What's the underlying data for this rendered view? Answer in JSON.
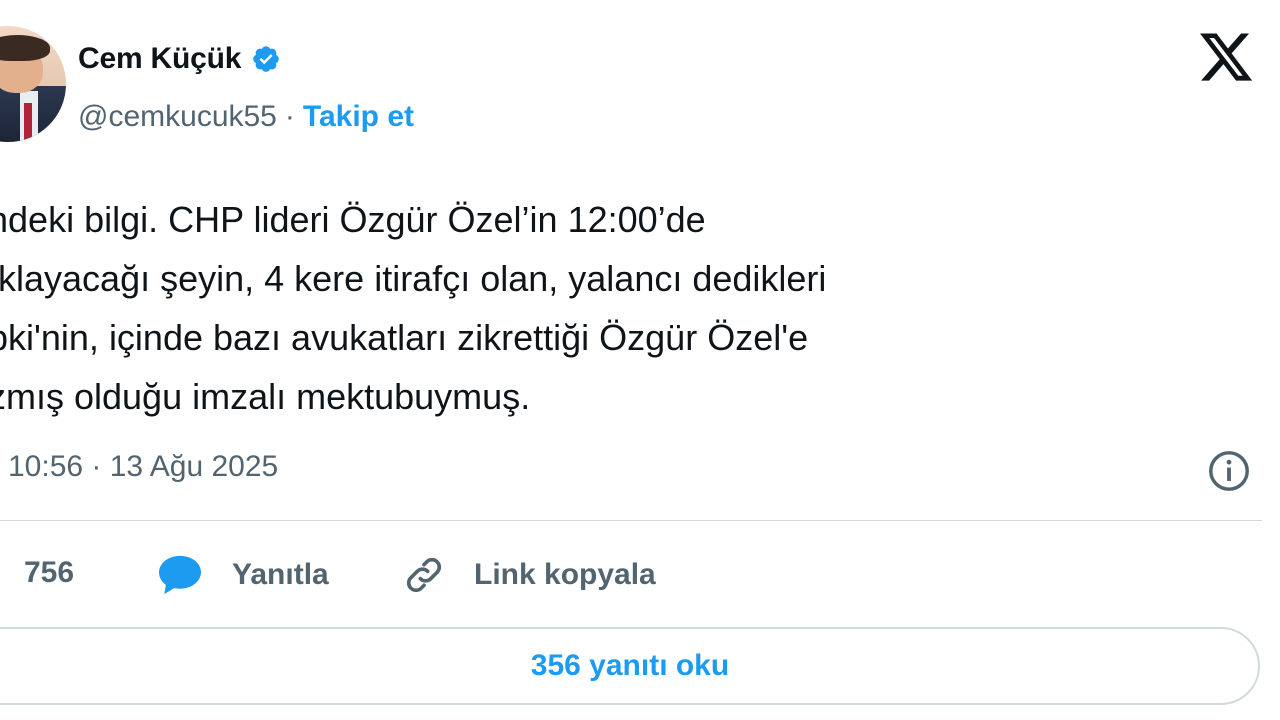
{
  "author": {
    "name": "Cem Küçük",
    "handle": "@cemkucuk55",
    "separator": "·",
    "follow_label": "Takip et"
  },
  "icons": {
    "verified": "verified-badge-icon",
    "platform": "x-logo-icon",
    "info": "info-icon",
    "reply": "reply-bubble-icon",
    "link": "link-icon"
  },
  "tweet": {
    "lines": [
      "ndeki bilgi. CHP lideri Özgür Özel’in 12:00’de",
      "ıklayacağı şeyin, 4 kere itirafçı olan, yalancı dedikleri",
      "pki'nin, içinde bazı avukatları zikrettiği Özgür Özel'e",
      "zmış olduğu imzalı mektubuymuş."
    ],
    "timestamp": "10:56 · 13 Ağu 2025"
  },
  "actions": {
    "like_count": "756",
    "reply_label": "Yanıtla",
    "copy_link_label": "Link kopyala"
  },
  "read_replies_label": "356 yanıtı oku",
  "colors": {
    "accent": "#1d9bf0",
    "secondary_text": "#536471",
    "primary_text": "#0f1419",
    "border": "#cfd9de"
  }
}
